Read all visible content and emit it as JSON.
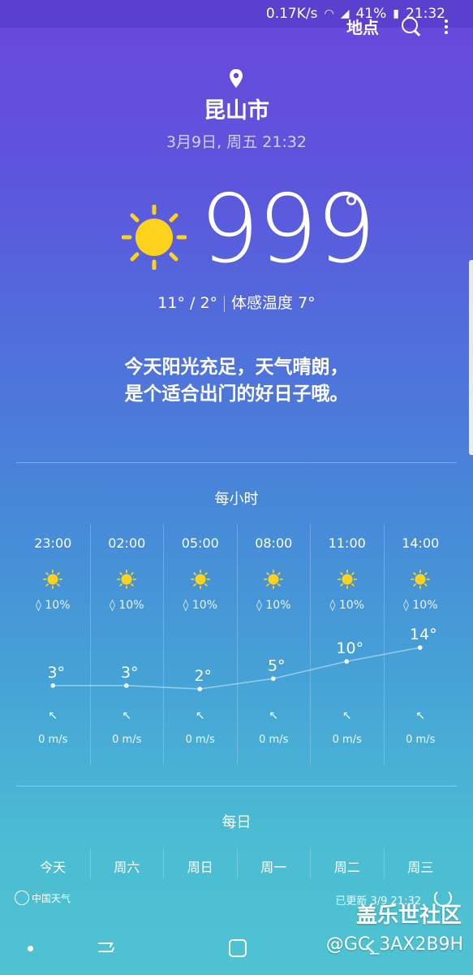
{
  "status_bar": {
    "speed": "0.17K/s",
    "battery": "41%",
    "time": "21:32"
  },
  "toolbar": {
    "locations_label": "地点"
  },
  "current": {
    "city": "昆山市",
    "datetime": "3月9日, 周五 21:32",
    "temperature": "999",
    "degree_symbol": "°",
    "high_low": "11° / 2°",
    "feels_like": "体感温度 7°",
    "description_line1": "今天阳光充足，天气晴朗，",
    "description_line2": "是个适合出门的好日子哦。",
    "sun_color": "#ffd21c"
  },
  "hourly": {
    "title": "每小时",
    "items": [
      {
        "time": "23:00",
        "rain": "10%",
        "wind_arrow": "↖",
        "wind": "0 m/s"
      },
      {
        "time": "02:00",
        "rain": "10%",
        "wind_arrow": "↖",
        "wind": "0 m/s"
      },
      {
        "time": "05:00",
        "rain": "10%",
        "wind_arrow": "↖",
        "wind": "0 m/s"
      },
      {
        "time": "08:00",
        "rain": "10%",
        "wind_arrow": "↖",
        "wind": "0 m/s"
      },
      {
        "time": "11:00",
        "rain": "10%",
        "wind_arrow": "↖",
        "wind": "0 m/s"
      },
      {
        "time": "14:00",
        "rain": "10%",
        "wind_arrow": "↖",
        "wind": "0 m/s"
      }
    ]
  },
  "chart_data": {
    "type": "line",
    "categories": [
      "23:00",
      "02:00",
      "05:00",
      "08:00",
      "11:00",
      "14:00"
    ],
    "values": [
      3,
      3,
      2,
      5,
      10,
      14
    ],
    "labels": [
      "3°",
      "3°",
      "2°",
      "5°",
      "10°",
      "14°"
    ],
    "title": "",
    "xlabel": "",
    "ylabel": "",
    "ylim": [
      2,
      14
    ]
  },
  "daily": {
    "title": "每日",
    "items": [
      "今天",
      "周六",
      "周日",
      "周一",
      "周二",
      "周三"
    ]
  },
  "footer": {
    "logo_text": "中国天气",
    "updated": "已更新 3/9 21:32"
  },
  "watermark": {
    "line1": "盖乐世社区",
    "line2": "@GC_3AX2B9H"
  }
}
